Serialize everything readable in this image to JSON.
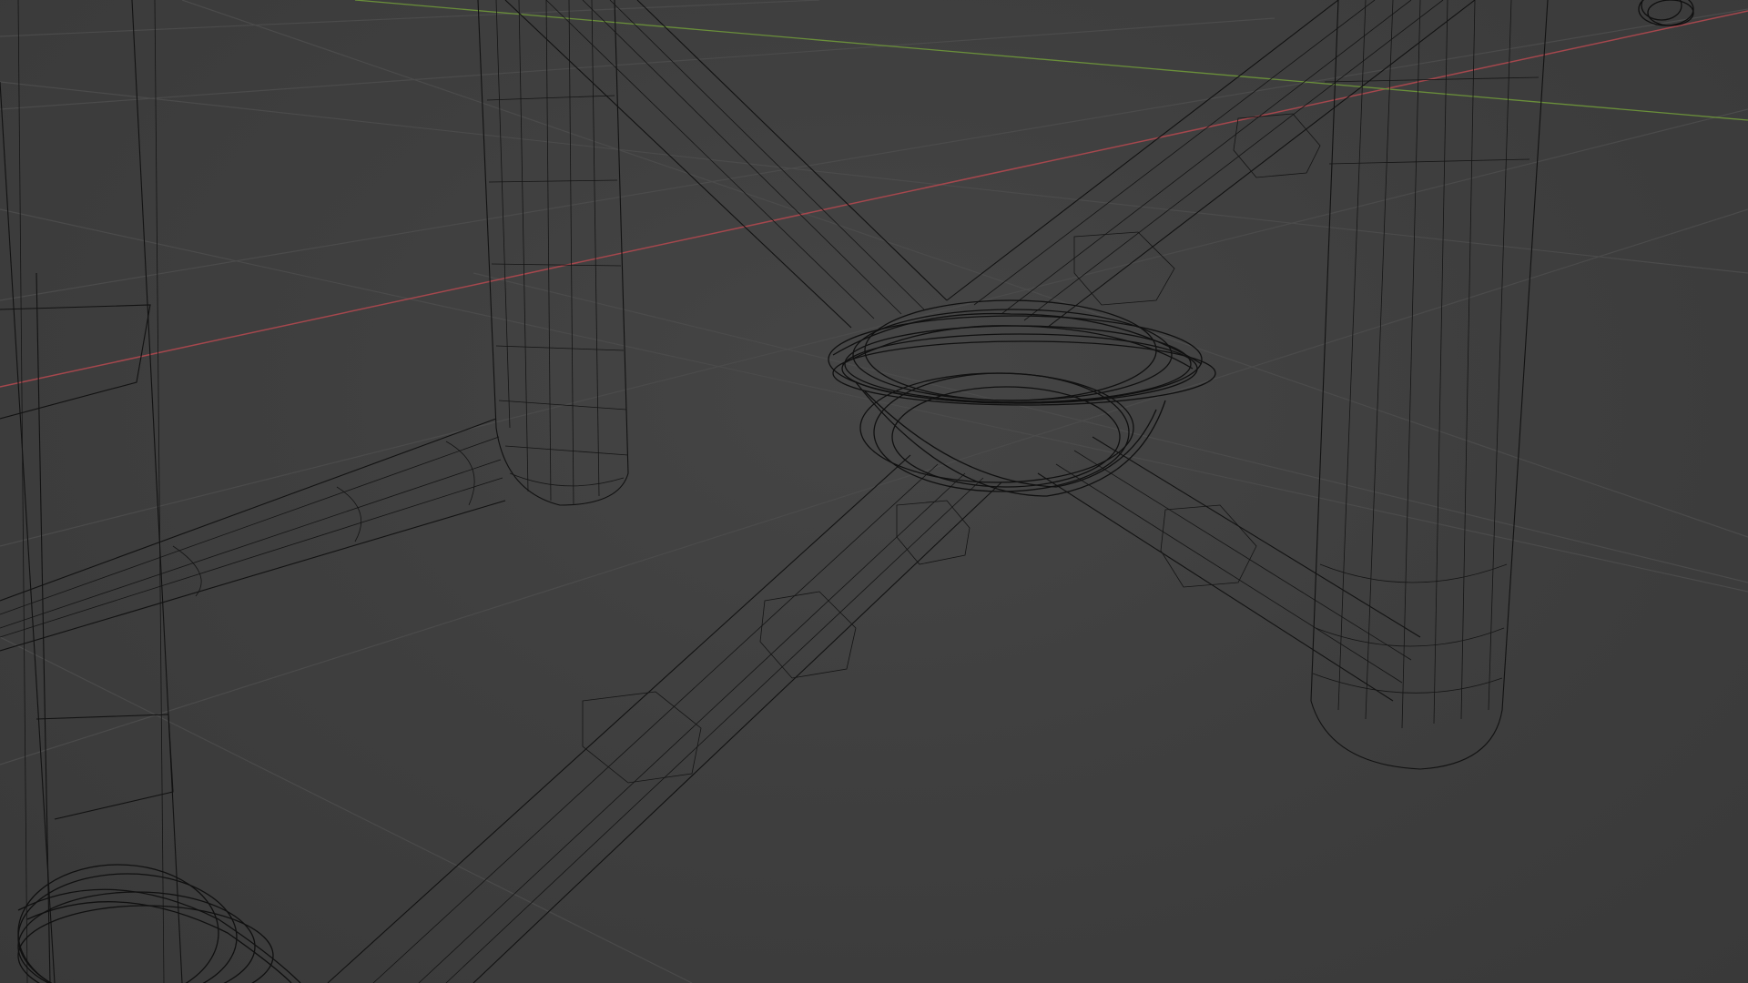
{
  "viewport": {
    "mode": "wireframe",
    "background_color": "#3f3f3f",
    "grid_color": "#4b4b4b",
    "wire_color": "#121212",
    "axis_x_color": "#a5474d",
    "axis_y_color": "#6a8f3a"
  }
}
